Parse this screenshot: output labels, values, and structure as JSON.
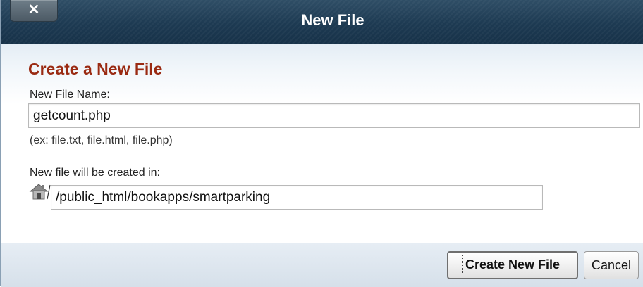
{
  "dialog": {
    "title": "New File",
    "close_label": "✕"
  },
  "form": {
    "heading": "Create a New File",
    "filename_label": "New File Name:",
    "filename_value": "getcount.php",
    "filename_hint": "(ex: file.txt, file.html, file.php)",
    "location_label": "New file will be created in:",
    "location_value": "/public_html/bookapps/smartparking",
    "location_icon": "home-icon"
  },
  "footer": {
    "create_label": "Create New File",
    "cancel_label": "Cancel"
  }
}
